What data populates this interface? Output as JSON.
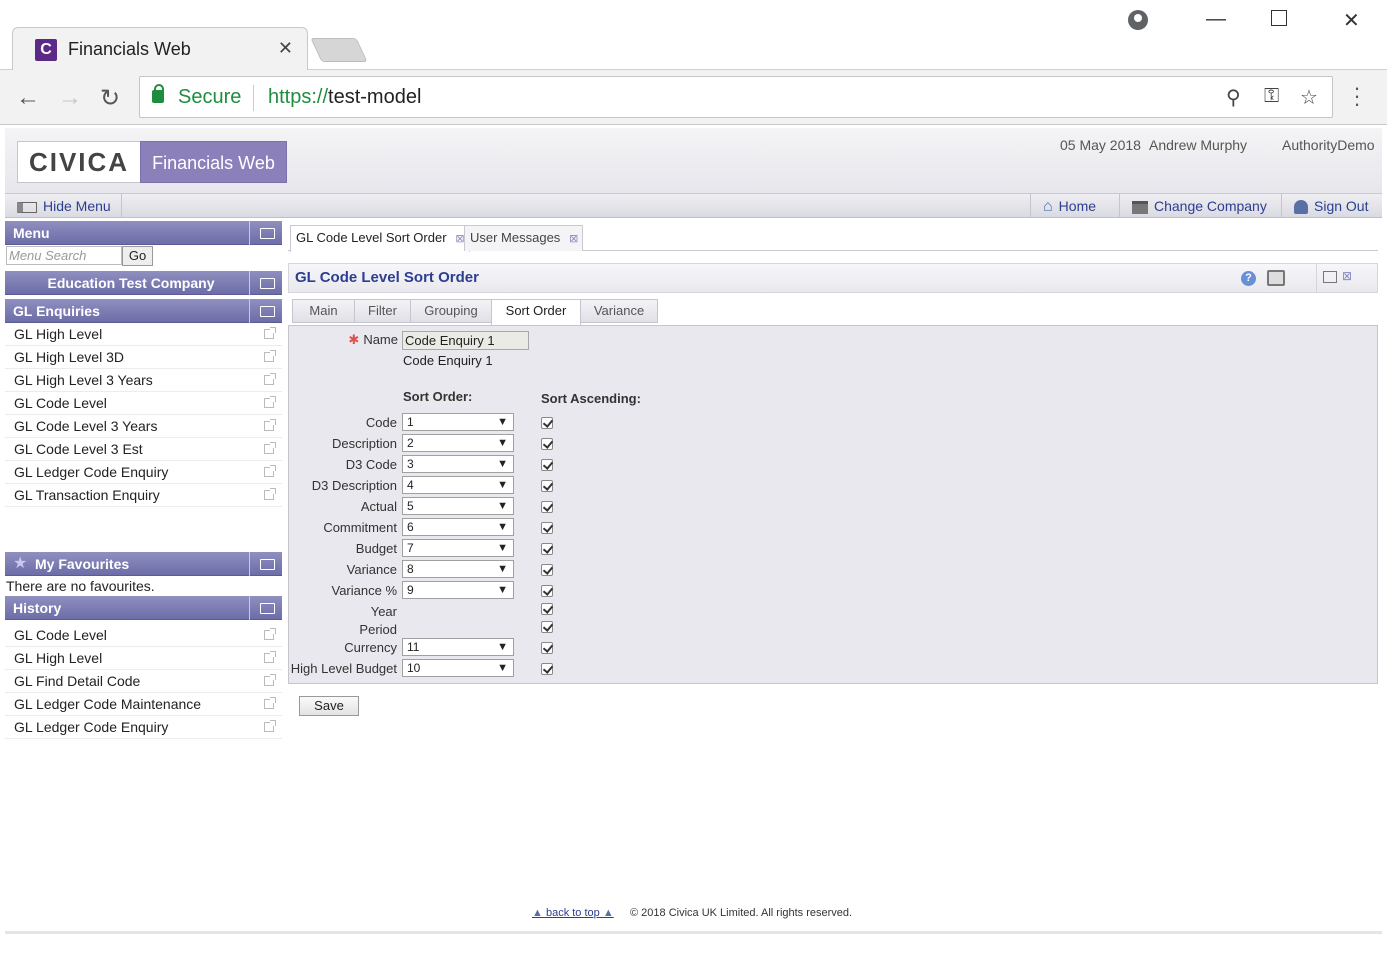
{
  "browser": {
    "tab_title": "Financials Web",
    "tab_favicon": "C",
    "secure_label": "Secure",
    "url_scheme": "https://",
    "url_host": "test-model"
  },
  "header": {
    "logo": "CIVICA",
    "product": "Financials Web",
    "date": "05 May 2018",
    "user": "Andrew Murphy",
    "authority": "AuthorityDemo"
  },
  "menubar": {
    "hide_menu": "Hide Menu",
    "home": "Home",
    "change_company": "Change Company",
    "sign_out": "Sign Out"
  },
  "sidebar": {
    "menu_title": "Menu",
    "search_placeholder": "Menu Search",
    "go_label": "Go",
    "company": "Education Test Company",
    "enquiries_title": "GL Enquiries",
    "enquiries": [
      "GL High Level",
      "GL High Level 3D",
      "GL High Level 3 Years",
      "GL Code Level",
      "GL Code Level 3 Years",
      "GL Code Level 3 Est",
      "GL Ledger Code Enquiry",
      "GL Transaction Enquiry"
    ],
    "favourites_title": "My Favourites",
    "favourites_note": "There are no favourites.",
    "history_title": "History",
    "history": [
      "GL Code Level",
      "GL High Level",
      "GL Find Detail Code",
      "GL Ledger Code Maintenance",
      "GL Ledger Code Enquiry"
    ]
  },
  "doc_tabs": [
    "GL Code Level Sort Order",
    "User Messages"
  ],
  "panel": {
    "title": "GL Code Level Sort Order",
    "help": "?"
  },
  "form_tabs": [
    "Main",
    "Filter",
    "Grouping",
    "Sort Order",
    "Variance"
  ],
  "form": {
    "name_label": "Name",
    "name_value": "Code Enquiry 1",
    "name_echo": "Code Enquiry 1",
    "sort_order_heading": "Sort Order:",
    "sort_ascending_heading": "Sort Ascending:",
    "rows": [
      {
        "label": "Code",
        "value": "1",
        "ascending": true
      },
      {
        "label": "Description",
        "value": "2",
        "ascending": true
      },
      {
        "label": "D3 Code",
        "value": "3",
        "ascending": true
      },
      {
        "label": "D3 Description",
        "value": "4",
        "ascending": true
      },
      {
        "label": "Actual",
        "value": "5",
        "ascending": true
      },
      {
        "label": "Commitment",
        "value": "6",
        "ascending": true
      },
      {
        "label": "Budget",
        "value": "7",
        "ascending": true
      },
      {
        "label": "Variance",
        "value": "8",
        "ascending": true
      },
      {
        "label": "Variance %",
        "value": "9",
        "ascending": true
      },
      {
        "label": "Year",
        "value": "",
        "ascending": true
      },
      {
        "label": "Period",
        "value": "",
        "ascending": true
      },
      {
        "label": "Currency",
        "value": "11",
        "ascending": true
      },
      {
        "label": "High Level Budget",
        "value": "10",
        "ascending": true
      }
    ],
    "save_label": "Save"
  },
  "footer": {
    "back_to_top": "back to top",
    "copyright": "© 2018 Civica UK Limited. All rights reserved."
  }
}
